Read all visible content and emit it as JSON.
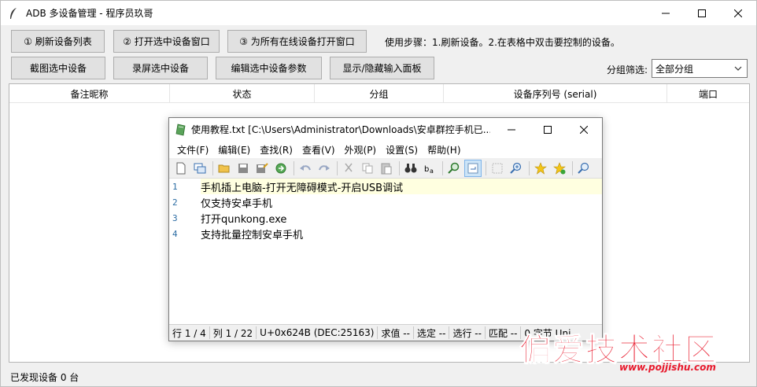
{
  "main": {
    "title": "ADB 多设备管理 - 程序员玖哥",
    "buttons": {
      "refresh": "① 刷新设备列表",
      "open_selected": "② 打开选中设备窗口",
      "open_all": "③ 为所有在线设备打开窗口",
      "screenshot": "截图选中设备",
      "record": "录屏选中设备",
      "edit_params": "编辑选中设备参数",
      "toggle_input": "显示/隐藏输入面板"
    },
    "help_text": "使用步骤：1.刷新设备。2.在表格中双击要控制的设备。",
    "filter": {
      "label": "分组筛选:",
      "selected": "全部分组"
    },
    "table": {
      "columns": [
        "备注昵称",
        "状态",
        "分组",
        "设备序列号 (serial)",
        "端口"
      ]
    },
    "status": "已发现设备 0 台"
  },
  "editor": {
    "title": "使用教程.txt [C:\\Users\\Administrator\\Downloads\\安卓群控手机已...",
    "menu": [
      "文件(F)",
      "编辑(E)",
      "查找(R)",
      "查看(V)",
      "外观(P)",
      "设置(S)",
      "帮助(H)"
    ],
    "lines": [
      {
        "no": "1",
        "text": "手机插上电脑-打开无障碍模式-开启USB调试"
      },
      {
        "no": "2",
        "text": "仅支持安卓手机"
      },
      {
        "no": "3",
        "text": "打开qunkong.exe"
      },
      {
        "no": "4",
        "text": "支持批量控制安卓手机"
      }
    ],
    "status": {
      "line": "行  1 / 4",
      "col": "列  1 / 22",
      "char": "U+0x624B (DEC:25163)",
      "sum": "求值  --",
      "sel": "选定  --",
      "sel_lines": "选行  --",
      "match": "匹配  --",
      "extra": "0 字节 Uni"
    }
  },
  "watermark": {
    "text": "偏爱技术社区",
    "url": "www.pojjishu.com"
  },
  "colors": {
    "watermark": "#e8192c",
    "current_line": "#ffffe0",
    "line_number": "#2b6ca3"
  }
}
